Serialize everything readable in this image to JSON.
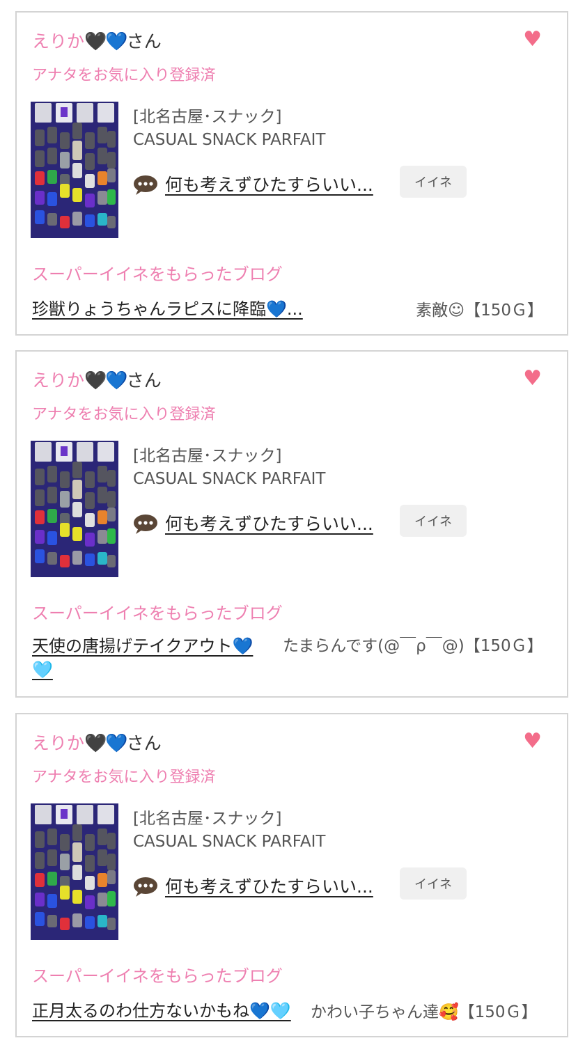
{
  "cards": [
    {
      "user_name": "えりか",
      "user_hearts": "🖤💙",
      "user_suffix": "さん",
      "favorite_status": "アナタをお気に入り登録済",
      "like_icon": "♥",
      "shop_category": "[北名古屋･スナック]",
      "shop_name": "CASUAL SNACK PARFAIT",
      "comment": "何も考えずひたすらいい...",
      "iine_label": "イイネ",
      "super_label": "スーパーイイネをもらったブログ",
      "blog_title": "珍獣りょうちゃんラピスに降臨💙...",
      "reward": "素敵☺【150Ｇ】"
    },
    {
      "user_name": "えりか",
      "user_hearts": "🖤💙",
      "user_suffix": "さん",
      "favorite_status": "アナタをお気に入り登録済",
      "like_icon": "♥",
      "shop_category": "[北名古屋･スナック]",
      "shop_name": "CASUAL SNACK PARFAIT",
      "comment": "何も考えずひたすらいい...",
      "iine_label": "イイネ",
      "super_label": "スーパーイイネをもらったブログ",
      "blog_title": "天使の唐揚げテイクアウト💙🩵",
      "reward": "たまらんです(@￣ρ￣@)【150Ｇ】"
    },
    {
      "user_name": "えりか",
      "user_hearts": "🖤💙",
      "user_suffix": "さん",
      "favorite_status": "アナタをお気に入り登録済",
      "like_icon": "♥",
      "shop_category": "[北名古屋･スナック]",
      "shop_name": "CASUAL SNACK PARFAIT",
      "comment": "何も考えずひたすらいい...",
      "iine_label": "イイネ",
      "super_label": "スーパーイイネをもらったブログ",
      "blog_title": "正月太るのわ仕方ないかもね💙🩵",
      "reward": "かわい子ちゃん達🥰【150Ｇ】"
    }
  ],
  "colors": {
    "accent_pink": "#ee7fb0",
    "heart_red": "#f36d8a",
    "button_gray": "#f0f0f0"
  }
}
